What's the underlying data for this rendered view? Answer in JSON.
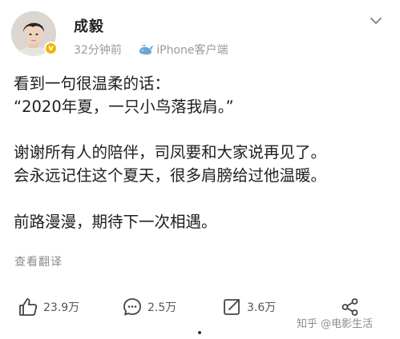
{
  "post": {
    "username": "成毅",
    "verified_badge": "v",
    "time": "32分钟前",
    "client": "iPhone客户端",
    "lines": [
      "看到一句很温柔的话：",
      "“2020年夏，一只小鸟落我肩。”",
      "谢谢所有人的陪伴，司凤要和大家说再见了。",
      "会永远记住这个夏天，很多肩膀给过他温暖。",
      "前路漫漫，期待下一次相遇。"
    ],
    "translate_label": "查看翻译"
  },
  "actions": {
    "likes": "23.9万",
    "comments": "2.5万",
    "reposts": "3.6万"
  },
  "watermark": "知乎 @电影生活",
  "colors": {
    "badge": "#f5b400",
    "meta_text": "#9a9a9a",
    "whale_icon": "#6aa6d6"
  }
}
